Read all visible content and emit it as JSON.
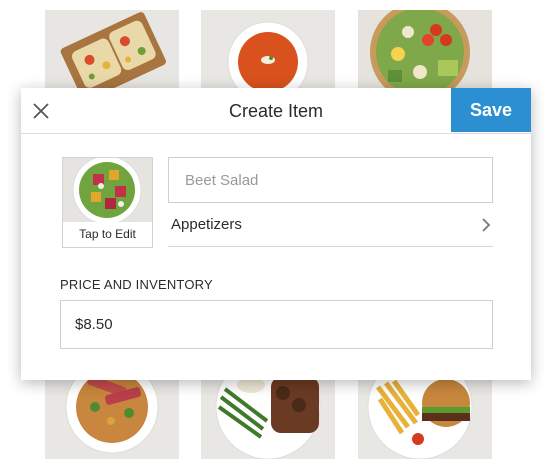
{
  "modal": {
    "title": "Create Item",
    "save_label": "Save"
  },
  "item": {
    "thumbnail_label": "Tap to Edit",
    "name_placeholder": "Beet Salad",
    "name_value": "",
    "category": "Appetizers"
  },
  "pricing": {
    "section_label": "PRICE AND INVENTORY",
    "price_value": "$8.50"
  },
  "icons": {
    "close": "close-icon",
    "category_chevron": "chevron-right-icon"
  },
  "colors": {
    "accent": "#2b8fd1"
  }
}
